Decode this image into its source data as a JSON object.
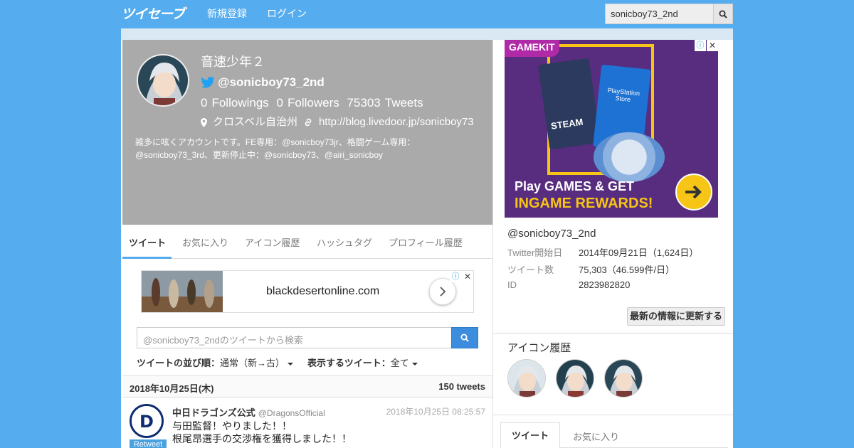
{
  "header": {
    "logo": "ツイセーブ",
    "nav": [
      "新規登録",
      "ログイン"
    ],
    "search_value": "sonicboy73_2nd"
  },
  "profile": {
    "name": "音速少年２",
    "handle": "@sonicboy73_2nd",
    "followings_count": "0",
    "followings_label": "Followings",
    "followers_count": "0",
    "followers_label": "Followers",
    "tweets_count": "75303",
    "tweets_label": "Tweets",
    "location": "クロスベル自治州",
    "url": "http://blog.livedoor.jp/sonicboy73",
    "bio": "雑多に呟くアカウントです。FE専用：@sonicboy73jr、格闘ゲーム専用：@sonicboy73_3rd、更新停止中：@sonicboy73、@airi_sonicboy"
  },
  "tabs": [
    "ツイート",
    "お気に入り",
    "アイコン履歴",
    "ハッシュタグ",
    "プロフィール履歴"
  ],
  "ad_banner": {
    "text": "blackdesertonline.com"
  },
  "tweet_search": {
    "placeholder": "@sonicboy73_2ndのツイートから検索"
  },
  "sort": {
    "order_label": "ツイートの並び順：",
    "order_value": "通常（新→古）",
    "filter_label": "表示するツイート：",
    "filter_value": "全て"
  },
  "date_header": {
    "date": "2018年10月25日(木)",
    "count": "150 tweets"
  },
  "tweet": {
    "name": "中日ドラゴンズ公式",
    "handle": "@DragonsOfficial",
    "time": "2018年10月25日 08:25:57",
    "badge": "Retweet",
    "line1": "与田監督！やりました！！",
    "line2": "根尾昂選手の交渉権を獲得しました！！"
  },
  "side_ad": {
    "logo": "GAMEKIT",
    "line1": "Play GAMES & GET",
    "line2": "INGAME REWARDS!",
    "card1": "STEAM",
    "card2": "PlayStation Store"
  },
  "side_info": {
    "handle": "@sonicboy73_2nd",
    "rows": [
      {
        "k": "Twitter開始日",
        "v": "2014年09月21日（1,624日）"
      },
      {
        "k": "ツイート数",
        "v": "75,303（46.599件/日）"
      },
      {
        "k": "ID",
        "v": "2823982820"
      }
    ],
    "update_button": "最新の情報に更新する",
    "icon_history_title": "アイコン履歴"
  },
  "side_tabs": [
    "ツイート",
    "お気に入り"
  ],
  "colors": {
    "brand": "#55acee",
    "profile_bg": "#aaaaaa",
    "button_blue": "#3c8dde"
  }
}
